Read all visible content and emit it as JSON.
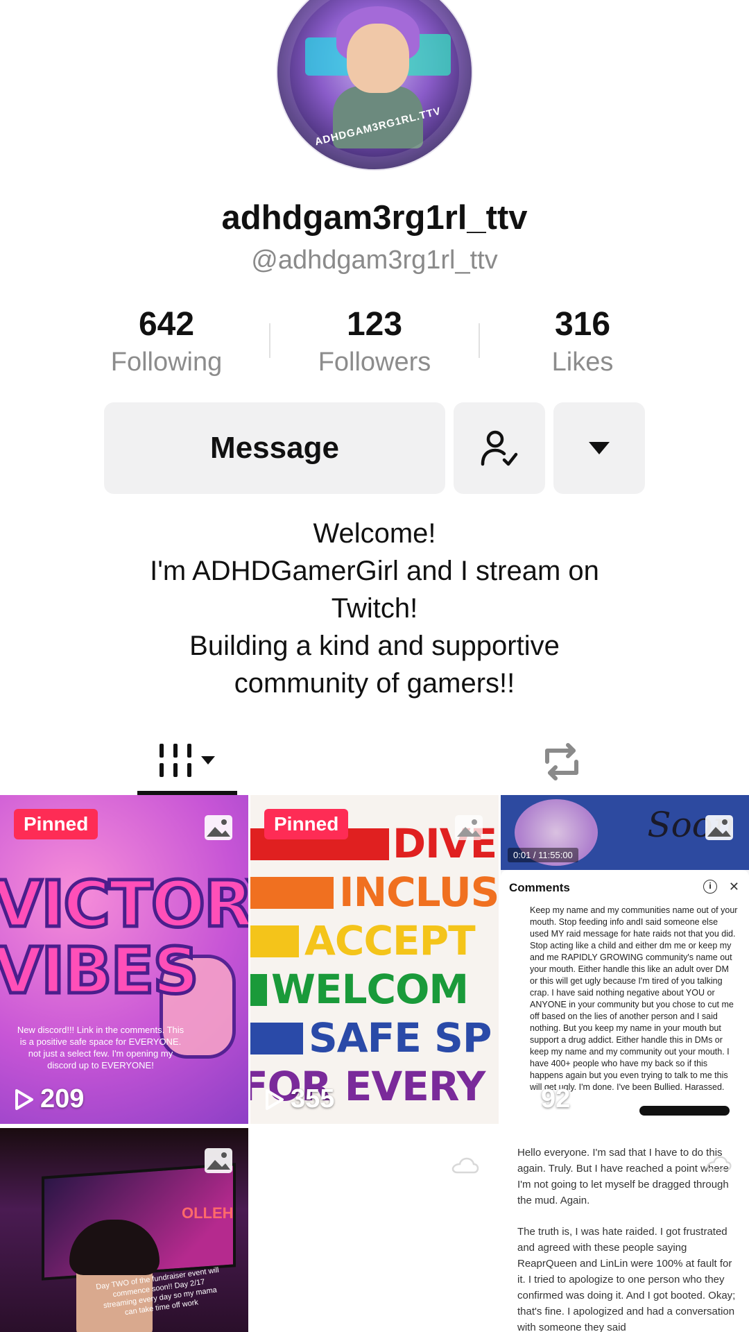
{
  "profile": {
    "avatar_text": "ADHDGAM3RG1RL.TTV",
    "display_name": "adhdgam3rg1rl_ttv",
    "handle": "@adhdgam3rg1rl_ttv"
  },
  "stats": {
    "following": {
      "value": "642",
      "label": "Following"
    },
    "followers": {
      "value": "123",
      "label": "Followers"
    },
    "likes": {
      "value": "316",
      "label": "Likes"
    }
  },
  "actions": {
    "message_label": "Message",
    "follow_icon": "person-check-icon",
    "more_icon": "caret-down-icon"
  },
  "bio": {
    "lines": [
      "Welcome!",
      "I'm ADHDGamerGirl and I stream on",
      "Twitch!",
      "Building a kind and supportive",
      "community of gamers!!"
    ]
  },
  "tabs": {
    "videos_icon": "grid-icon",
    "reposts_icon": "repost-icon"
  },
  "posts": [
    {
      "pinned": "Pinned",
      "title_line1": "VICTORY",
      "title_line2": "VIBES",
      "caption": "New discord!!! Link in the comments. This is a positive safe space for EVERYONE. not just a select few. I'm opening my discord up to EVERYONE!",
      "views": "209",
      "type_icon": "photo-icon"
    },
    {
      "pinned": "Pinned",
      "words": [
        "DIVE",
        "INCLUS",
        "ACCEPT",
        "WELCOM",
        "SAFE SP",
        "FOR EVERY"
      ],
      "views": "355",
      "type_icon": "photo-icon"
    },
    {
      "top_word": "Soon",
      "timestamp": "0:01 / 11:55:00",
      "sheet_title": "Comments",
      "comment": "Keep my name and my communities name out of your mouth. Stop feeding info andI said someone else used MY raid message for hate raids not that you did. Stop acting like a child and either dm me or keep my and me RAPIDLY GROWING community's name out your mouth. Either handle this like an adult over DM or this will get ugly because I'm tired of you talking crap. I have said nothing negative about YOU or ANYONE in your community but you chose to cut me off based on the lies of another person and I said nothing. But you keep my name in your mouth but support a drug addict. Either handle this in DMs or keep my name and my community out your mouth. I have 400+ people who have my back so if this happens again but you even trying to talk to me this will get ugly. I'm done. I've been Bullied. Harassed.",
      "views": "92",
      "type_icon": "photo-icon"
    },
    {
      "neon_text": "OLLEH",
      "caption": "Day TWO of the fundraiser event will commence soon!! Day 2/17 streaming every day so my mama can take time off work",
      "type_icon": "photo-icon"
    },
    {
      "type_icon": "cloud-icon"
    },
    {
      "paragraph1": "Hello everyone. I'm sad that I have to do this again. Truly. But I have reached a point where I'm not going to let myself be dragged through the mud. Again.",
      "paragraph2": "The truth is, I was hate raided. I got frustrated and agreed with these people saying ReaprQueen and LinLin were 100% at fault for it. I tried to apologize to one person who they confirmed was doing it. And I got booted. Okay; that's fine. I apologized and had a conversation with someone they said",
      "type_icon": "cloud-icon"
    }
  ],
  "colors": {
    "pinned": "#fe2c55",
    "button_bg": "#f1f1f2",
    "muted_text": "#8a8a8a"
  }
}
